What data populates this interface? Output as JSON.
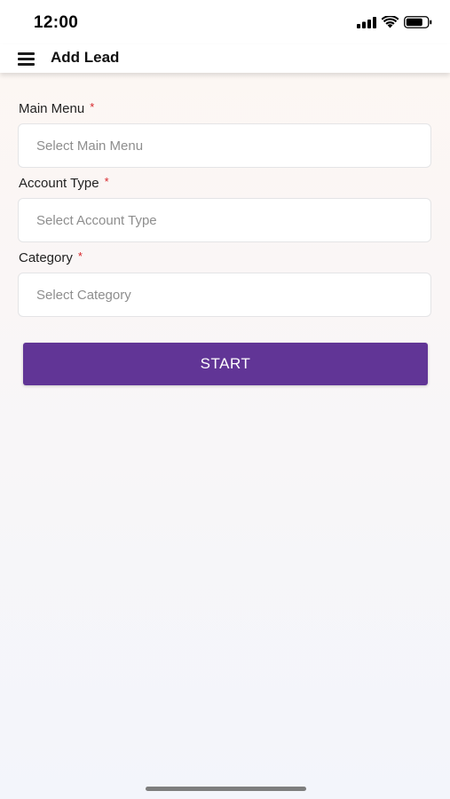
{
  "status_bar": {
    "time": "12:00",
    "icons": [
      "signal-icon",
      "wifi-icon",
      "battery-icon"
    ]
  },
  "app_bar": {
    "menu_icon": "hamburger-menu-icon",
    "title": "Add Lead"
  },
  "form": {
    "main_menu": {
      "label": "Main Menu",
      "required_mark": "*",
      "placeholder": "Select Main Menu"
    },
    "account_type": {
      "label": "Account Type",
      "required_mark": "*",
      "placeholder": "Select Account Type"
    },
    "category": {
      "label": "Category",
      "required_mark": "*",
      "placeholder": "Select Category"
    },
    "start_label": "START"
  },
  "colors": {
    "primary": "#613596",
    "required": "#d7262b",
    "placeholder": "#8e8e8e"
  }
}
